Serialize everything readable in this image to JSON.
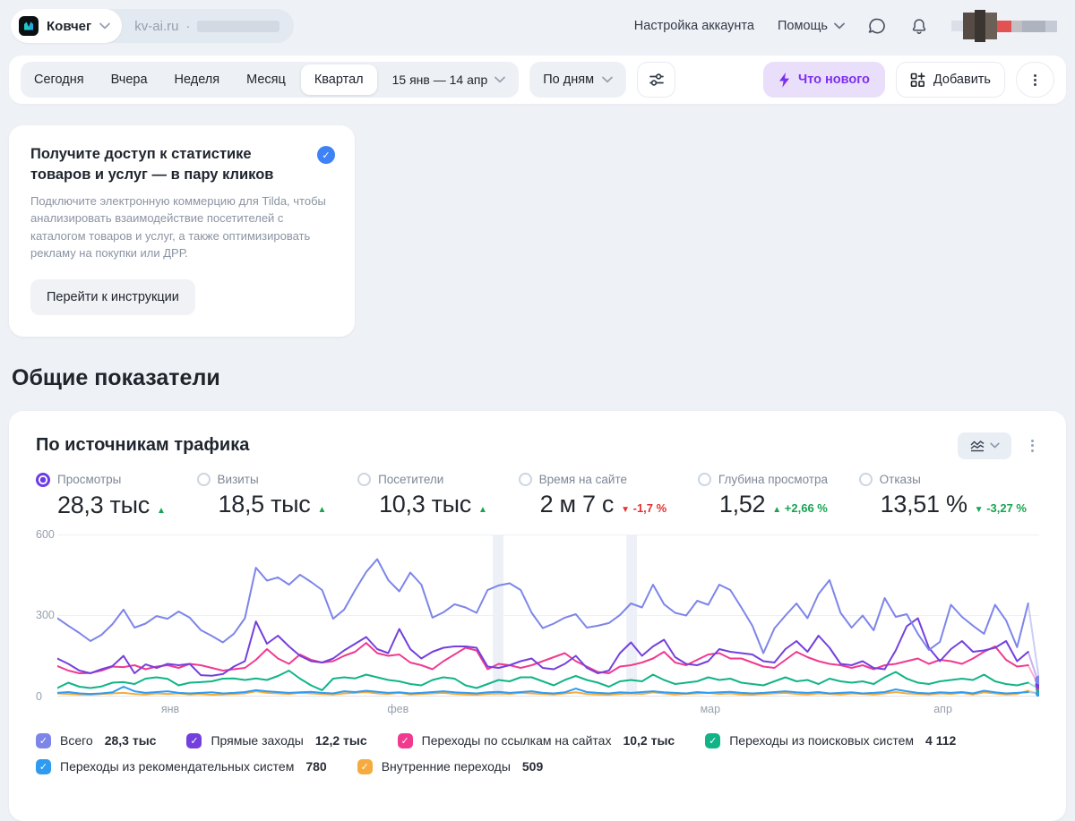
{
  "header": {
    "counter_name": "Ковчег",
    "counter_domain": "kv-ai.ru",
    "separator": "·",
    "account_settings": "Настройка аккаунта",
    "help": "Помощь"
  },
  "filter_bar": {
    "periods": [
      "Сегодня",
      "Вчера",
      "Неделя",
      "Месяц",
      "Квартал"
    ],
    "selected_period": "Квартал",
    "date_range": "15 янв — 14 апр",
    "grouping": "По дням",
    "whats_new": "Что нового",
    "add": "Добавить"
  },
  "promo_card": {
    "title": "Получите доступ к статистике товаров и услуг — в пару кликов",
    "body": "Подключите электронную коммерцию для Tilda, чтобы анализировать взаимодействие посетителей с каталогом товаров и услуг, а также оптимизировать рекламу на покупки или ДРР.",
    "button": "Перейти к инструкции"
  },
  "section_title": "Общие показатели",
  "chart_card": {
    "title": "По источникам трафика",
    "metrics": [
      {
        "id": "views",
        "label": "Просмотры",
        "value": "28,3 тыс",
        "delta_dir": "up",
        "delta_text": "",
        "delta_color": "#17a550",
        "selected": true
      },
      {
        "id": "visits",
        "label": "Визиты",
        "value": "18,5 тыс",
        "delta_dir": "up",
        "delta_text": "",
        "delta_color": "#17a550",
        "selected": false
      },
      {
        "id": "visitors",
        "label": "Посетители",
        "value": "10,3 тыс",
        "delta_dir": "up",
        "delta_text": "",
        "delta_color": "#17a550",
        "selected": false
      },
      {
        "id": "time",
        "label": "Время на сайте",
        "value": "2 м 7 с",
        "delta_dir": "down",
        "delta_text": "-1,7 %",
        "delta_color": "#e53231",
        "selected": false
      },
      {
        "id": "depth",
        "label": "Глубина просмотра",
        "value": "1,52",
        "delta_dir": "up",
        "delta_text": "+2,66 %",
        "delta_color": "#17a550",
        "selected": false
      },
      {
        "id": "bounce",
        "label": "Отказы",
        "value": "13,51 %",
        "delta_dir": "down",
        "delta_text": "-3,27 %",
        "delta_color": "#17a550",
        "selected": false
      }
    ]
  },
  "chart_data": {
    "type": "line",
    "title": "По источникам трафика",
    "x_range": "15 янв — 14 апр, по дням",
    "ylim": [
      0,
      600
    ],
    "yticks": [
      0,
      300,
      600
    ],
    "grid": true,
    "month_labels": [
      {
        "label": "янв",
        "frac": 0.115
      },
      {
        "label": "фев",
        "frac": 0.347
      },
      {
        "label": "мар",
        "frac": 0.665
      },
      {
        "label": "апр",
        "frac": 0.902
      }
    ],
    "highlight_bands": [
      0.449,
      0.585
    ],
    "series": [
      {
        "name": "Всего",
        "total": "28,3 тыс",
        "color": "#7d85e9",
        "legend_row": 1,
        "values": [
          290,
          262,
          235,
          205,
          228,
          268,
          322,
          255,
          270,
          298,
          288,
          315,
          292,
          246,
          224,
          200,
          232,
          290,
          478,
          430,
          442,
          415,
          452,
          425,
          395,
          288,
          322,
          395,
          462,
          510,
          432,
          390,
          460,
          415,
          292,
          312,
          342,
          330,
          310,
          395,
          412,
          420,
          395,
          310,
          253,
          270,
          292,
          305,
          255,
          262,
          272,
          302,
          345,
          330,
          415,
          342,
          310,
          300,
          355,
          340,
          415,
          395,
          330,
          262,
          160,
          252,
          300,
          345,
          290,
          380,
          432,
          310,
          255,
          300,
          245,
          365,
          295,
          305,
          232,
          172,
          202,
          340,
          295,
          262,
          232,
          340,
          282,
          182,
          345,
          60
        ]
      },
      {
        "name": "Прямые заходы",
        "total": "12,2 тыс",
        "color": "#7440dd",
        "legend_row": 1,
        "values": [
          140,
          120,
          95,
          85,
          100,
          112,
          150,
          85,
          118,
          105,
          120,
          115,
          120,
          78,
          76,
          82,
          110,
          130,
          278,
          195,
          225,
          185,
          150,
          130,
          125,
          140,
          170,
          195,
          220,
          175,
          160,
          250,
          175,
          140,
          165,
          180,
          185,
          185,
          180,
          110,
          105,
          115,
          130,
          140,
          105,
          100,
          120,
          150,
          105,
          85,
          95,
          160,
          200,
          150,
          185,
          210,
          145,
          120,
          115,
          130,
          175,
          165,
          160,
          155,
          130,
          125,
          175,
          205,
          165,
          225,
          180,
          120,
          115,
          130,
          105,
          100,
          170,
          260,
          290,
          180,
          130,
          175,
          205,
          165,
          170,
          180,
          205,
          130,
          165,
          42
        ]
      },
      {
        "name": "Переходы по ссылкам на сайтах",
        "total": "10,2 тыс",
        "color": "#f03a90",
        "legend_row": 1,
        "values": [
          112,
          95,
          85,
          86,
          95,
          110,
          108,
          115,
          100,
          110,
          115,
          105,
          120,
          115,
          105,
          95,
          100,
          105,
          135,
          175,
          140,
          120,
          155,
          135,
          125,
          130,
          150,
          165,
          198,
          160,
          150,
          155,
          125,
          115,
          100,
          130,
          155,
          180,
          170,
          100,
          120,
          115,
          105,
          115,
          130,
          145,
          160,
          130,
          110,
          90,
          85,
          110,
          115,
          125,
          140,
          165,
          125,
          115,
          135,
          155,
          160,
          140,
          140,
          125,
          110,
          105,
          135,
          165,
          145,
          130,
          120,
          115,
          105,
          115,
          100,
          115,
          120,
          130,
          140,
          120,
          135,
          130,
          120,
          140,
          165,
          185,
          135,
          110,
          115,
          35
        ]
      },
      {
        "name": "Переходы из поисковых систем",
        "total": "4 112",
        "color": "#11b487",
        "legend_row": 1,
        "values": [
          30,
          50,
          35,
          30,
          36,
          50,
          52,
          45,
          65,
          70,
          64,
          40,
          50,
          52,
          55,
          65,
          66,
          60,
          66,
          60,
          75,
          95,
          65,
          40,
          22,
          65,
          70,
          66,
          80,
          70,
          60,
          55,
          45,
          40,
          60,
          70,
          65,
          40,
          30,
          45,
          60,
          55,
          70,
          70,
          55,
          40,
          60,
          75,
          60,
          50,
          35,
          55,
          60,
          55,
          80,
          60,
          45,
          50,
          55,
          70,
          60,
          65,
          50,
          45,
          40,
          55,
          70,
          55,
          60,
          45,
          65,
          55,
          50,
          55,
          45,
          70,
          90,
          65,
          50,
          45,
          55,
          60,
          65,
          60,
          80,
          55,
          45,
          40,
          50,
          26
        ]
      },
      {
        "name": "Переходы из рекомендательных систем",
        "total": "780",
        "color": "#2e9bf0",
        "legend_row": 2,
        "values": [
          12,
          15,
          10,
          8,
          10,
          14,
          35,
          18,
          12,
          15,
          18,
          12,
          10,
          12,
          14,
          10,
          12,
          15,
          22,
          18,
          15,
          12,
          14,
          16,
          12,
          10,
          18,
          15,
          20,
          16,
          12,
          14,
          10,
          12,
          15,
          18,
          14,
          12,
          10,
          14,
          16,
          12,
          15,
          18,
          12,
          10,
          14,
          28,
          15,
          12,
          10,
          14,
          12,
          15,
          18,
          14,
          12,
          10,
          15,
          12,
          14,
          16,
          12,
          10,
          12,
          15,
          18,
          14,
          12,
          15,
          10,
          12,
          14,
          10,
          12,
          15,
          25,
          18,
          12,
          10,
          14,
          12,
          15,
          10,
          20,
          14,
          10,
          12,
          15,
          10
        ]
      },
      {
        "name": "Внутренние переходы",
        "total": "509",
        "color": "#f6ab3e",
        "legend_row": 2,
        "values": [
          10,
          8,
          6,
          5,
          8,
          10,
          12,
          8,
          6,
          10,
          8,
          10,
          6,
          8,
          5,
          6,
          8,
          10,
          18,
          12,
          10,
          8,
          12,
          10,
          8,
          6,
          10,
          12,
          15,
          10,
          8,
          12,
          6,
          8,
          10,
          12,
          8,
          6,
          5,
          8,
          10,
          8,
          12,
          10,
          8,
          6,
          10,
          14,
          8,
          6,
          5,
          8,
          10,
          8,
          14,
          10,
          6,
          8,
          10,
          12,
          8,
          10,
          6,
          5,
          8,
          10,
          12,
          8,
          6,
          10,
          8,
          6,
          10,
          8,
          6,
          10,
          15,
          10,
          8,
          6,
          10,
          8,
          12,
          6,
          14,
          10,
          6,
          8,
          20,
          8
        ]
      }
    ]
  }
}
